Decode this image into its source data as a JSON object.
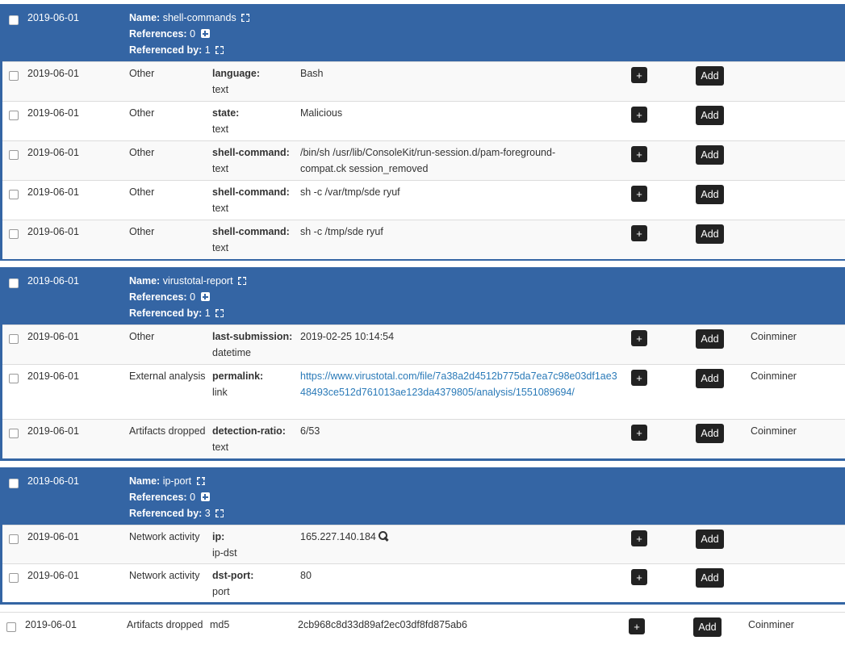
{
  "labels": {
    "name": "Name:",
    "references": "References:",
    "referenced_by": "Referenced by:",
    "add_button": "Add",
    "plus_button": "+"
  },
  "objects": [
    {
      "date": "2019-06-01",
      "name": "shell-commands",
      "references": "0",
      "referenced_by": "1",
      "attributes": [
        {
          "date": "2019-06-01",
          "category": "Other",
          "relation": "language:",
          "type": "text",
          "value": "Bash",
          "tag": ""
        },
        {
          "date": "2019-06-01",
          "category": "Other",
          "relation": "state:",
          "type": "text",
          "value": "Malicious",
          "tag": ""
        },
        {
          "date": "2019-06-01",
          "category": "Other",
          "relation": "shell-command:",
          "type": "text",
          "value": "/bin/sh /usr/lib/ConsoleKit/run-session.d/pam-foreground-compat.ck session_removed",
          "tag": ""
        },
        {
          "date": "2019-06-01",
          "category": "Other",
          "relation": "shell-command:",
          "type": "text",
          "value": "sh -c /var/tmp/sde ryuf",
          "tag": ""
        },
        {
          "date": "2019-06-01",
          "category": "Other",
          "relation": "shell-command:",
          "type": "text",
          "value": "sh -c /tmp/sde ryuf",
          "tag": ""
        }
      ]
    },
    {
      "date": "2019-06-01",
      "name": "virustotal-report",
      "references": "0",
      "referenced_by": "1",
      "attributes": [
        {
          "date": "2019-06-01",
          "category": "Other",
          "relation": "last-submission:",
          "type": "datetime",
          "value": "2019-02-25 10:14:54",
          "tag": "Coinminer"
        },
        {
          "date": "2019-06-01",
          "category": "External analysis",
          "relation": "permalink:",
          "type": "link",
          "value": "https://www.virustotal.com/file/7a38a2d4512b775da7ea7c98e03df1ae348493ce512d761013ae123da4379805/analysis/1551089694/",
          "tag": "Coinminer"
        },
        {
          "date": "2019-06-01",
          "category": "Artifacts dropped",
          "relation": "detection-ratio:",
          "type": "text",
          "value": "6/53",
          "tag": "Coinminer"
        }
      ]
    },
    {
      "date": "2019-06-01",
      "name": "ip-port",
      "references": "0",
      "referenced_by": "3",
      "attributes": [
        {
          "date": "2019-06-01",
          "category": "Network activity",
          "relation": "ip:",
          "type": "ip-dst",
          "value": "165.227.140.184",
          "tag": ""
        },
        {
          "date": "2019-06-01",
          "category": "Network activity",
          "relation": "dst-port:",
          "type": "port",
          "value": "80",
          "tag": ""
        }
      ]
    }
  ],
  "standalone": [
    {
      "date": "2019-06-01",
      "category": "Artifacts dropped",
      "type": "md5",
      "value": "2cb968c8d33d89af2ec03df8fd875ab6",
      "tag": "Coinminer"
    }
  ]
}
